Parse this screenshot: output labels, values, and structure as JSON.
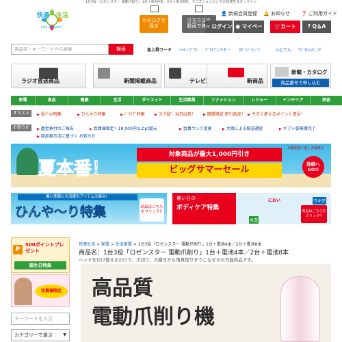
{
  "top_strip": "1台3役「ロゼンスター 電動爪削り」1台＋電池4本／2台＋電池8本。ラジオショッピングの快適生活オンライン",
  "logo": {
    "text_left": "快適",
    "text_right": "生活",
    "sub": "Life Support"
  },
  "header": {
    "catalog_btn": [
      "カタログを",
      "見る"
    ],
    "order_btn": [
      "注文方法を",
      "動画で確認"
    ],
    "new_member": "新規会員登録",
    "shopping_guide": "お知らせ",
    "order_guide": "ご利用ガイド",
    "login": "ログイン",
    "mypage": "マイページ",
    "cart": "カート",
    "qa": "Q＆A"
  },
  "search": {
    "placeholder": "商品名・キーワードから検索",
    "button": "検索",
    "keywords_label": "急上昇ワード",
    "keywords": [
      "ｼｬｲﾆｰﾌﾞﾗｼ",
      "ﾄﾞﾗｲﾌﾞﾚｺｰﾀﾞｰ",
      "ｽﾎﾟﾝｼﾞｷｭｰﾌﾞ",
      "ふむてん",
      "ﾗｼﾞｵｼｮｯﾋﾟﾝｸﾞ"
    ]
  },
  "categories": [
    "ラジオ放送商品",
    "新聞掲載商品",
    "テレビ放送商品",
    "新商品",
    "新聞・カタログ",
    "商品番号で申し込む"
  ],
  "nav": [
    "家電",
    "食品",
    "健康",
    "生活",
    "ダイエット",
    "生活雑貨",
    "ファッション",
    "レジャー",
    "インテリア",
    "美容"
  ],
  "osusume_label": "オススメ",
  "osusume": [
    "夏ｸﾞﾙﾒ特集",
    "ひんやり特集",
    "ﾄﾞﾗｲﾌﾞ特集",
    "スグ配！当日出荷！",
    "期間限定 割引商品！",
    "今すぐ使えるポイント進呈！"
  ],
  "notice_label": "お知らせ",
  "notices": [
    "基金寄付のご報告",
    "会員様限定！18,000円以上pt還元",
    "会員ランク変更",
    "大雨による配送遅延",
    "ギフト袋無償完了",
    "商品表示法に基づく お知らせ"
  ],
  "banner_main": {
    "title": "夏本番！",
    "badge": "対象商品が最大1,000円引き",
    "sale": "ビッグサマーセール",
    "note": "※限定数に達し次第終了",
    "more": "詳細へGO!!"
  },
  "banner_cool": {
    "top": "暑い季節に大活躍のアイテム大集合！",
    "title": "ひんや〜り特集",
    "click": "商品はこちらをクリック!!"
  },
  "banner_body": {
    "top": "暑い日の",
    "title": "ボディケア特集",
    "tag1": "におい",
    "tag2": "ワキ汗",
    "tag3": "水虫",
    "click": "商品はこちらをクリック!!"
  },
  "sidebar": {
    "point": "500ポイントプレゼント",
    "birthday": "誕生日特典",
    "register": "会員様限定",
    "keyword_placeholder": "キーワードを入力",
    "category_select": "カテゴリーで選ぶ"
  },
  "breadcrumb": [
    "快適生活",
    "家電",
    "生活家電",
    "1台3役「ロゼンスター 電動爪削り」1台＋電池4本／2台＋電池8本"
  ],
  "product_title": "商品名：1台3役「ロゼンスター 電動爪削り」1台＋電池4本／2台＋電池8本",
  "product_sub": "ヘッドを付け替えるだけで、爪切り、爪磨きから角質削りまでこなせるの万能商品です。",
  "hero": {
    "line1": "高品質",
    "line2": "電動爪削り機"
  },
  "colors": {
    "green": "#2f9d3a",
    "red": "#e8001c",
    "orange": "#f08a00",
    "blue": "#1060b0"
  }
}
